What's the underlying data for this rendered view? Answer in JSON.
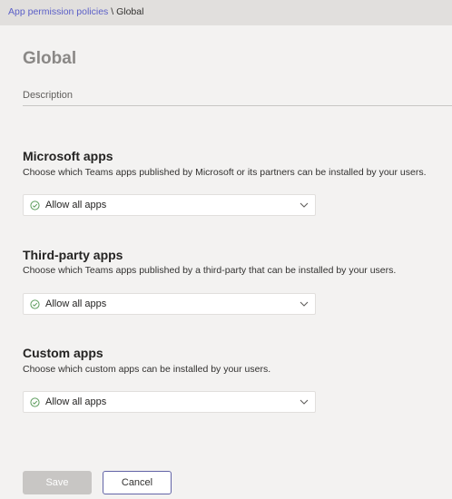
{
  "breadcrumb": {
    "parent": "App permission policies",
    "separator": "\\",
    "current": "Global"
  },
  "page": {
    "title": "Global",
    "description_label": "Description"
  },
  "sections": [
    {
      "title": "Microsoft apps",
      "description": "Choose which Teams apps published by Microsoft or its partners can be installed by your users.",
      "dropdown_value": "Allow all apps"
    },
    {
      "title": "Third-party apps",
      "description": "Choose which Teams apps published by a third-party that can be installed by your users.",
      "dropdown_value": "Allow all apps"
    },
    {
      "title": "Custom apps",
      "description": "Choose which custom apps can be installed by your users.",
      "dropdown_value": "Allow all apps"
    }
  ],
  "buttons": {
    "save_label": "Save",
    "cancel_label": "Cancel"
  },
  "colors": {
    "accent": "#6264a7",
    "check_green": "#5c9c5c",
    "background": "#f3f2f1"
  },
  "icons": {
    "dropdown_status": "check-circle-icon",
    "dropdown_toggle": "chevron-down-icon"
  }
}
